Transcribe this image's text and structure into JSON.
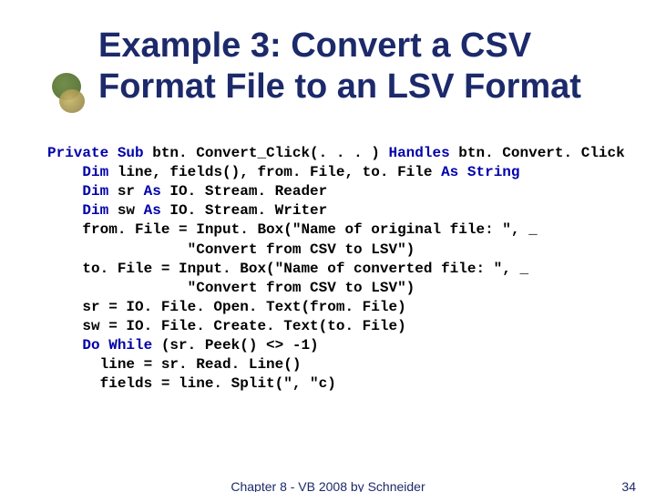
{
  "title": "Example 3: Convert a CSV Format File to an LSV Format",
  "code": {
    "kw_private_sub": "Private Sub",
    "sig": " btn. Convert_Click(. . . ) ",
    "kw_handles": "Handles",
    "sig_tail": " btn. Convert. Click",
    "ind4": "    ",
    "kw_dim1": "Dim",
    "dim1_rest": " line, fields(), from. File, to. File ",
    "kw_as1": "As String",
    "kw_dim2": "Dim",
    "dim2_mid": " sr ",
    "kw_as2": "As",
    "dim2_rest": " IO. Stream. Reader",
    "kw_dim3": "Dim",
    "dim3_mid": " sw ",
    "kw_as3": "As",
    "dim3_rest": " IO. Stream. Writer",
    "l5": "    from. File = Input. Box(\"Name of original file: \", _",
    "l6": "                \"Convert from CSV to LSV\")",
    "l7": "    to. File = Input. Box(\"Name of converted file: \", _",
    "l8": "                \"Convert from CSV to LSV\")",
    "l9": "    sr = IO. File. Open. Text(from. File)",
    "l10": "    sw = IO. File. Create. Text(to. File)",
    "kw_do_while": "Do While",
    "l11_rest": " (sr. Peek() <> -1)",
    "l12": "      line = sr. Read. Line()",
    "l13": "      fields = line. Split(\", \"c)"
  },
  "footer": {
    "center": "Chapter 8 - VB 2008 by Schneider",
    "page": "34"
  }
}
